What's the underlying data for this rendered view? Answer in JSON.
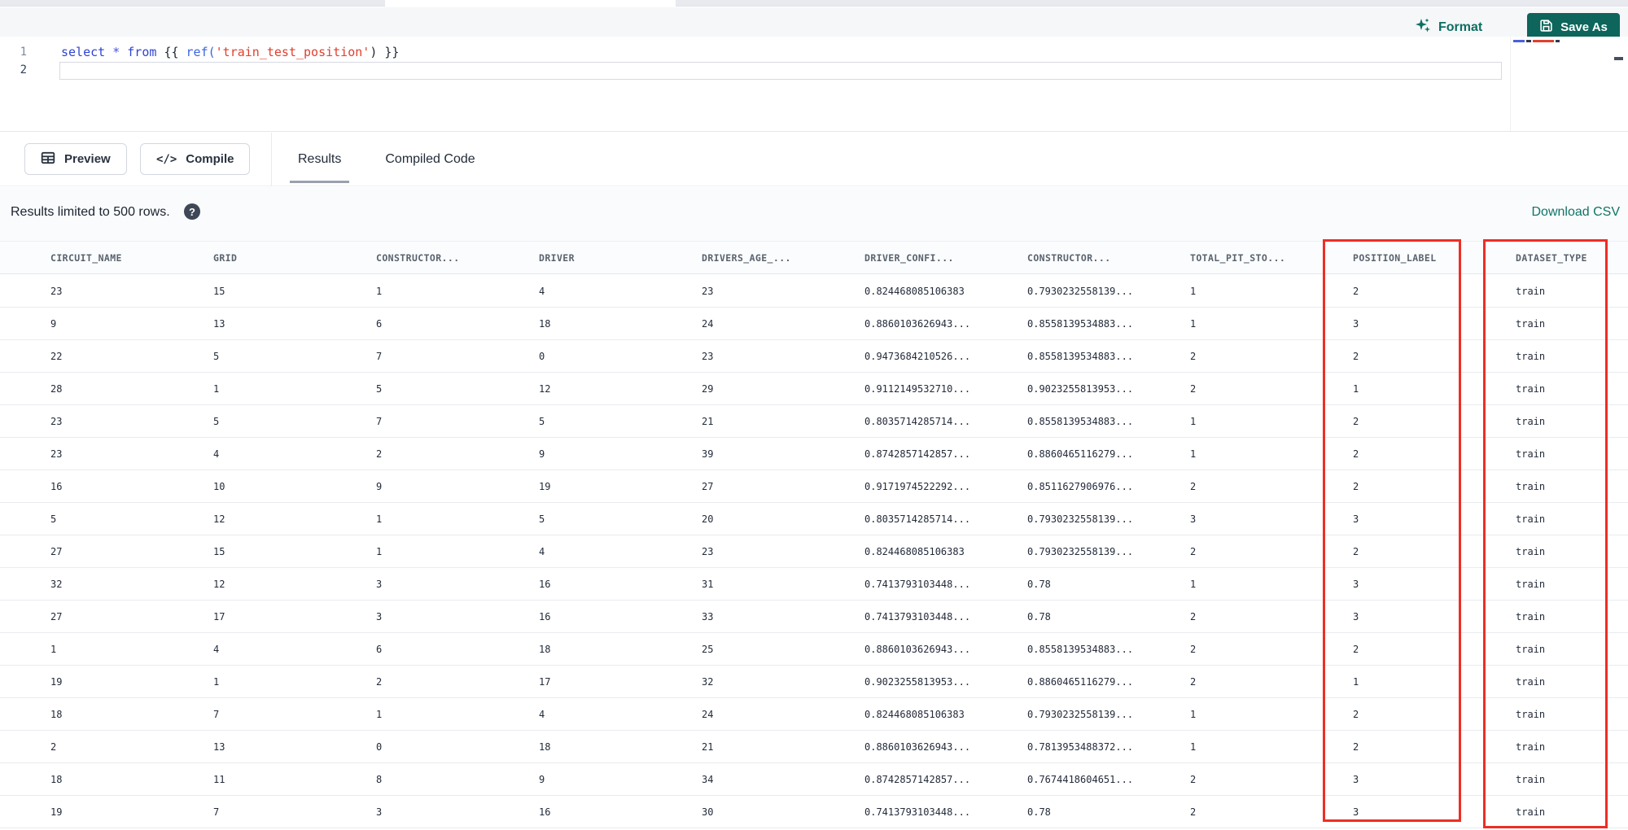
{
  "toolbar": {
    "format_label": "Format",
    "save_as_label": "Save As"
  },
  "editor": {
    "line_numbers": [
      "1",
      "2"
    ],
    "lines": [
      {
        "number": "1",
        "text": "select * from {{ ref('train_test_position') }}",
        "tokens": [
          {
            "t": "select",
            "c": "kw"
          },
          {
            "t": " ",
            "c": "pl"
          },
          {
            "t": "*",
            "c": "op"
          },
          {
            "t": " ",
            "c": "pl"
          },
          {
            "t": "from",
            "c": "kw"
          },
          {
            "t": " ",
            "c": "pl"
          },
          {
            "t": "{{ ",
            "c": "br"
          },
          {
            "t": "ref(",
            "c": "fn"
          },
          {
            "t": "'train_test_position'",
            "c": "str"
          },
          {
            "t": ") ",
            "c": "br"
          },
          {
            "t": "}}",
            "c": "br"
          }
        ]
      },
      {
        "number": "2",
        "text": ""
      }
    ]
  },
  "actions": {
    "preview_label": "Preview",
    "compile_label": "Compile",
    "compile_glyph": "</>"
  },
  "tabs": [
    {
      "label": "Results",
      "active": true
    },
    {
      "label": "Compiled Code",
      "active": false
    }
  ],
  "results": {
    "limit_note": "Results limited to 500 rows.",
    "help_icon_glyph": "?",
    "download_label": "Download CSV"
  },
  "table": {
    "columns": [
      "CIRCUIT_NAME",
      "GRID",
      "CONSTRUCTOR...",
      "DRIVER",
      "DRIVERS_AGE_...",
      "DRIVER_CONFI...",
      "CONSTRUCTOR...",
      "TOTAL_PIT_STO...",
      "POSITION_LABEL",
      "DATASET_TYPE"
    ],
    "rows": [
      [
        "23",
        "15",
        "1",
        "4",
        "23",
        "0.824468085106383",
        "0.7930232558139...",
        "1",
        "2",
        "train"
      ],
      [
        "9",
        "13",
        "6",
        "18",
        "24",
        "0.8860103626943...",
        "0.8558139534883...",
        "1",
        "3",
        "train"
      ],
      [
        "22",
        "5",
        "7",
        "0",
        "23",
        "0.9473684210526...",
        "0.8558139534883...",
        "2",
        "2",
        "train"
      ],
      [
        "28",
        "1",
        "5",
        "12",
        "29",
        "0.9112149532710...",
        "0.9023255813953...",
        "2",
        "1",
        "train"
      ],
      [
        "23",
        "5",
        "7",
        "5",
        "21",
        "0.8035714285714...",
        "0.8558139534883...",
        "1",
        "2",
        "train"
      ],
      [
        "23",
        "4",
        "2",
        "9",
        "39",
        "0.8742857142857...",
        "0.8860465116279...",
        "1",
        "2",
        "train"
      ],
      [
        "16",
        "10",
        "9",
        "19",
        "27",
        "0.9171974522292...",
        "0.8511627906976...",
        "2",
        "2",
        "train"
      ],
      [
        "5",
        "12",
        "1",
        "5",
        "20",
        "0.8035714285714...",
        "0.7930232558139...",
        "3",
        "3",
        "train"
      ],
      [
        "27",
        "15",
        "1",
        "4",
        "23",
        "0.824468085106383",
        "0.7930232558139...",
        "2",
        "2",
        "train"
      ],
      [
        "32",
        "12",
        "3",
        "16",
        "31",
        "0.7413793103448...",
        "0.78",
        "1",
        "3",
        "train"
      ],
      [
        "27",
        "17",
        "3",
        "16",
        "33",
        "0.7413793103448...",
        "0.78",
        "2",
        "3",
        "train"
      ],
      [
        "1",
        "4",
        "6",
        "18",
        "25",
        "0.8860103626943...",
        "0.8558139534883...",
        "2",
        "2",
        "train"
      ],
      [
        "19",
        "1",
        "2",
        "17",
        "32",
        "0.9023255813953...",
        "0.8860465116279...",
        "2",
        "1",
        "train"
      ],
      [
        "18",
        "7",
        "1",
        "4",
        "24",
        "0.824468085106383",
        "0.7930232558139...",
        "1",
        "2",
        "train"
      ],
      [
        "2",
        "13",
        "0",
        "18",
        "21",
        "0.8860103626943...",
        "0.7813953488372...",
        "1",
        "2",
        "train"
      ],
      [
        "18",
        "11",
        "8",
        "9",
        "34",
        "0.8742857142857...",
        "0.7674418604651...",
        "2",
        "3",
        "train"
      ],
      [
        "19",
        "7",
        "3",
        "16",
        "30",
        "0.7413793103448...",
        "0.78",
        "2",
        "3",
        "train"
      ]
    ]
  },
  "annotations": {
    "color": "#ee2e24",
    "boxed_columns": [
      "POSITION_LABEL",
      "DATASET_TYPE"
    ]
  },
  "colors": {
    "accent_teal": "#0d655b",
    "link_teal": "#0f7468",
    "annotation_red": "#ee2e24",
    "header_text": "#59636f",
    "cell_text": "#232b3a"
  }
}
